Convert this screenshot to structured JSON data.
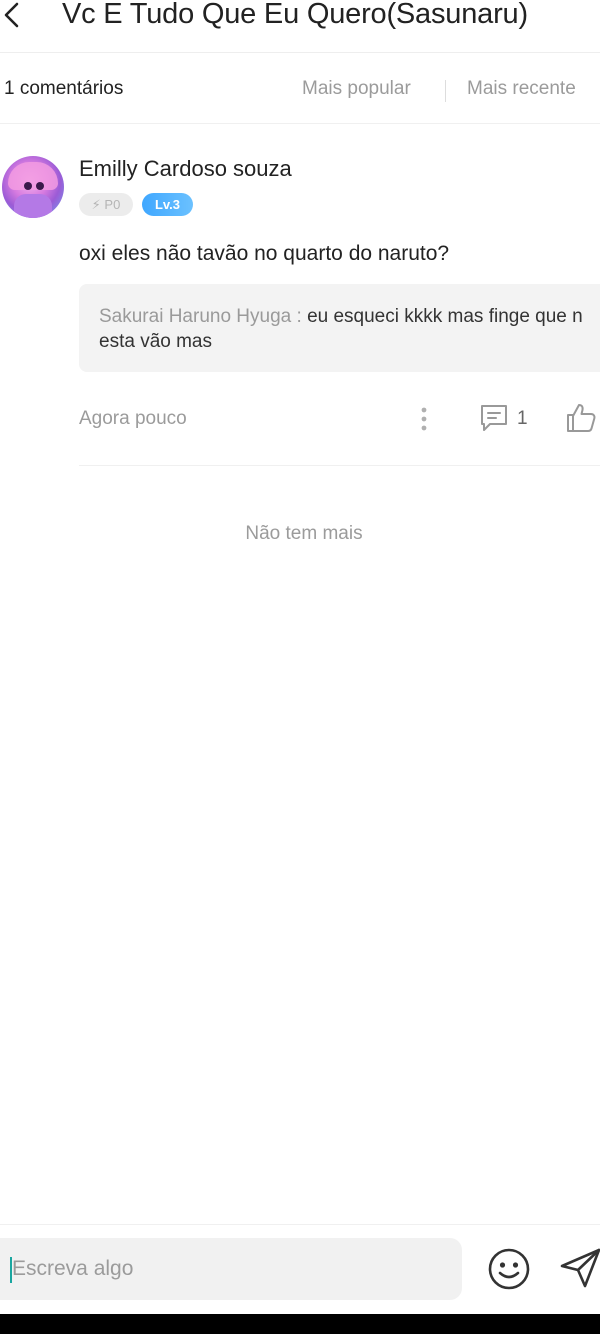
{
  "header": {
    "title": "Vc E Tudo Que Eu Quero(Sasunaru)"
  },
  "sort_bar": {
    "count_label": "1 comentários",
    "popular_label": "Mais popular",
    "recent_label": "Mais recente"
  },
  "comment": {
    "username": "Emilly Cardoso souza",
    "badge_points": "P0",
    "badge_level": "Lv.3",
    "text": "oxi eles não tavão no quarto do naruto?",
    "reply": {
      "author": "Sakurai Haruno Hyuga : ",
      "text": "eu esqueci kkkk mas finge que n esta vão mas"
    },
    "time": "Agora pouco",
    "reply_count": "1"
  },
  "end_message": "Não tem mais",
  "footer": {
    "input_placeholder": "Escreva algo"
  },
  "colors": {
    "level_badge": "#3fa7ff",
    "caret": "#1aa6a0"
  }
}
